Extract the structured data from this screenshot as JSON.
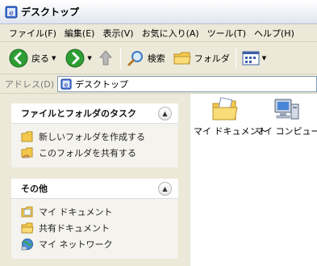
{
  "window": {
    "title": "デスクトップ"
  },
  "menu": [
    "ファイル(F)",
    "編集(E)",
    "表示(V)",
    "お気に入り(A)",
    "ツール(T)",
    "ヘルプ(H)"
  ],
  "toolbar": {
    "back_label": "戻る",
    "search_label": "検索",
    "folders_label": "フォルダ"
  },
  "address": {
    "label": "アドレス(D)",
    "value": "デスクトップ"
  },
  "tasks_box": {
    "title": "ファイルとフォルダのタスク",
    "items": [
      "新しいフォルダを作成する",
      "このフォルダを共有する"
    ]
  },
  "other_box": {
    "title": "その他",
    "items": [
      "マイ ドキュメント",
      "共有ドキュメント",
      "マイ ネットワーク"
    ]
  },
  "desktop_items": [
    "マイ ドキュメント",
    "マイ コンピュータ"
  ]
}
